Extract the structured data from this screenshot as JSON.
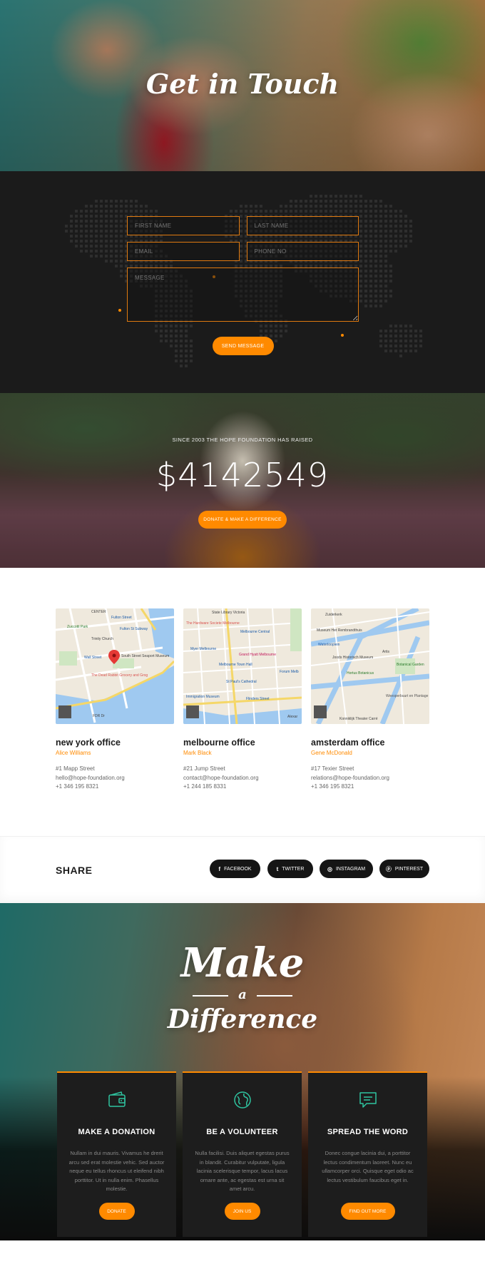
{
  "hero": {
    "title": "Get in Touch"
  },
  "contact_form": {
    "first_name_placeholder": "FIRST NAME",
    "last_name_placeholder": "LAST NAME",
    "email_placeholder": "EMAIL",
    "phone_placeholder": "PHONE NO",
    "message_placeholder": "MESSAGE",
    "send_label": "SEND MESSAGE"
  },
  "raised": {
    "label": "SINCE 2003 THE HOPE FOUNDATION HAS RAISED",
    "amount": "$4142549",
    "button_label": "DONATE & MAKE A DIFFERENCE"
  },
  "offices": [
    {
      "name": "new york office",
      "person": "Alice Williams",
      "address": "#1 Mapp Street",
      "email": "hello@hope-foundation.org",
      "phone": "+1 346 195 8321"
    },
    {
      "name": "melbourne office",
      "person": "Mark Black",
      "address": "#21 Jump Street",
      "email": "contact@hope-foundation.org",
      "phone": "+1 244 185 8331"
    },
    {
      "name": "amsterdam office",
      "person": "Gene McDonald",
      "address": "#17 Texier Street",
      "email": "relations@hope-foundation.org",
      "phone": "+1 346 195 8321"
    }
  ],
  "maps": {
    "ny": [
      "CENTER",
      "Fulton Street",
      "Zuccotti Park",
      "Fulton St Subway",
      "Trinity Church",
      "Wall Street",
      "South Street Seaport Museum",
      "The Dead Rabbit Grocery and Grog",
      "FDR Dr"
    ],
    "mel": [
      "State Library Victoria",
      "The Hardware Societe Melbourne",
      "Melbourne Central",
      "Myer Melbourne",
      "Grand Hyatt Melbourne",
      "Melbourne Town Hall",
      "St Paul's Cathedral",
      "Forum Melb",
      "Immigration Museum",
      "Flinders Street",
      "Alexar"
    ],
    "ams": [
      "Zuiderkerk",
      "Museum Het Rembrandthuis",
      "Waterlooplein",
      "Joods Historisch Museum",
      "Hortus Botanicus",
      "Artis",
      "Botanical Garden",
      "Weesperbuurt en Plantage",
      "Konniklijk Theater Carré"
    ]
  },
  "share": {
    "title": "SHARE",
    "buttons": [
      {
        "icon": "facebook-icon",
        "glyph": "f",
        "label": "FACEBOOK"
      },
      {
        "icon": "twitter-icon",
        "glyph": "t",
        "label": "TWITTER"
      },
      {
        "icon": "instagram-icon",
        "glyph": "◎",
        "label": "INSTAGRAM"
      },
      {
        "icon": "pinterest-icon",
        "glyph": "ⓟ",
        "label": "PINTEREST"
      }
    ]
  },
  "difference": {
    "line1": "Make",
    "line2": "a",
    "line3": "Difference",
    "cards": [
      {
        "icon": "wallet-icon",
        "title": "MAKE A DONATION",
        "text": "Nullam in dui mauris. Vivamus he drerit arcu sed erat molestie vehic. Sed auctor neque eu tellus rhoncus ut eleifend nibh porttitor. Ut in nulla enim. Phasellus molestie.",
        "button": "DONATE"
      },
      {
        "icon": "globe-icon",
        "title": "BE A VOLUNTEER",
        "text": "Nulla facilisi. Duis aliquet egestas purus in blandit. Curabitur vulputate, ligula lacinia scelerisque tempor, lacus lacus ornare ante, ac egestas est urna sit amet arcu.",
        "button": "JOIN US"
      },
      {
        "icon": "message-icon",
        "title": "SPREAD THE WORD",
        "text": "Donec congue lacinia dui, a porttitor lectus condimentum laoreet. Nunc eu ullamcorper orci. Quisque eget odio ac lectus vestibulum faucibus eget in.",
        "button": "FIND OUT MORE"
      }
    ]
  },
  "colors": {
    "accent": "#ff8a00",
    "dark": "#1b1b1b",
    "card": "#1d1d1d"
  }
}
